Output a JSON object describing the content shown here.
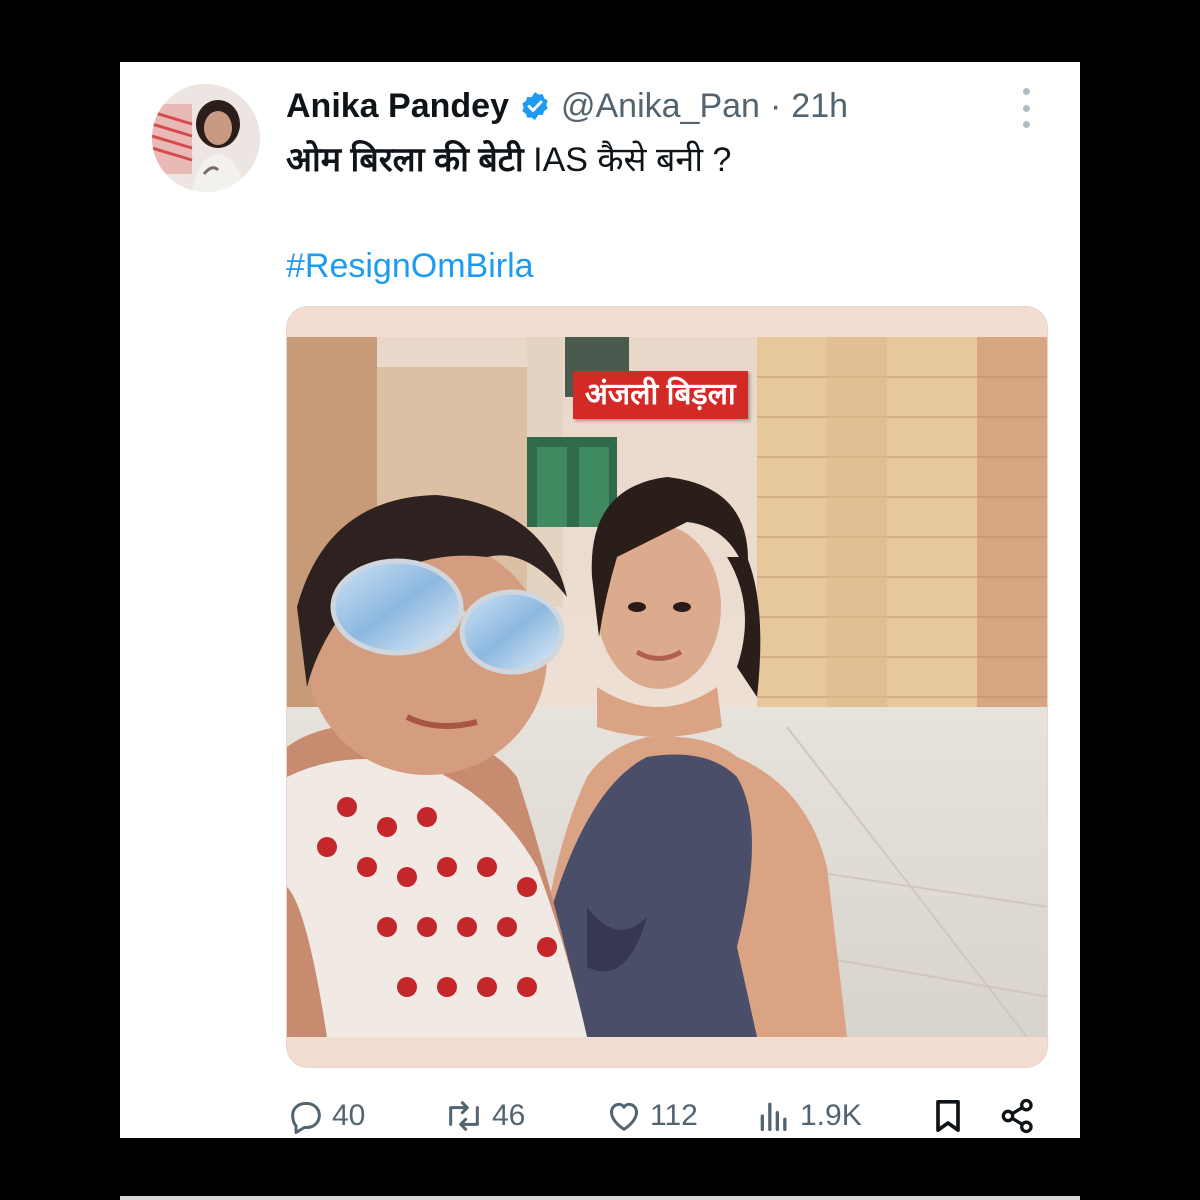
{
  "tweet": {
    "author_name": "Anika Pandey",
    "handle": "@Anika_Pan",
    "separator": "·",
    "time": "21h",
    "text_bold": "ओम बिरला की बेटी",
    "text_rest": " IAS कैसे बनी ?",
    "hashtag": "#ResignOmBirla",
    "verified_color": "#1d9bf0",
    "link_color": "#1d9bf0"
  },
  "media": {
    "label": "अंजली बिड़ला",
    "label_color": "#d32a26"
  },
  "actions": {
    "replies": "40",
    "reposts": "46",
    "likes": "112",
    "views": "1.9K"
  },
  "icons": {
    "verified": "verified-badge-icon",
    "more": "more-options-icon",
    "reply": "reply-icon",
    "repost": "repost-icon",
    "like": "heart-icon",
    "views": "views-icon",
    "bookmark": "bookmark-icon",
    "share": "share-icon"
  }
}
